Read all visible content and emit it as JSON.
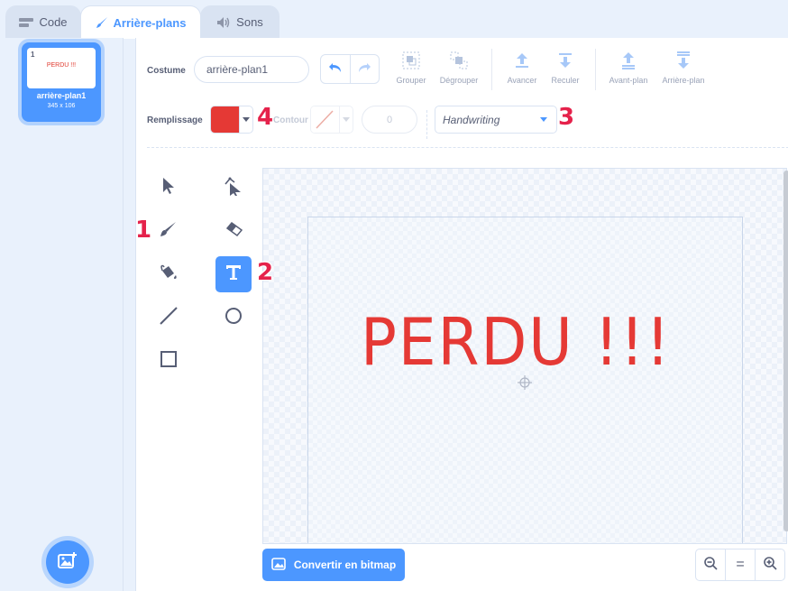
{
  "tabs": [
    {
      "label": "Code",
      "icon": "code-icon"
    },
    {
      "label": "Arrière-plans",
      "icon": "brush-icon"
    },
    {
      "label": "Sons",
      "icon": "speaker-icon"
    }
  ],
  "costume_list": {
    "items": [
      {
        "index": "1",
        "thumb_text": "PERDU !!!",
        "name": "arrière-plan1",
        "size": "345 x 106"
      }
    ]
  },
  "toolbar": {
    "costume_label": "Costume",
    "costume_name": "arrière-plan1",
    "group": "Grouper",
    "ungroup": "Dégrouper",
    "forward": "Avancer",
    "backward": "Reculer",
    "front": "Avant-plan",
    "back": "Arrière-plan",
    "fill_label": "Remplissage",
    "fill_color": "#e53935",
    "outline_label": "Contour",
    "outline_width": "0",
    "font": "Handwriting"
  },
  "markers": {
    "m1": "1",
    "m2": "2",
    "m3": "3",
    "m4": "4"
  },
  "canvas": {
    "text": "PERDU !!!"
  },
  "bottom": {
    "convert": "Convertir en bitmap",
    "zoom_reset": "="
  },
  "colors": {
    "accent": "#4c97ff",
    "text_red": "#e53935",
    "marker": "#e5224b"
  }
}
